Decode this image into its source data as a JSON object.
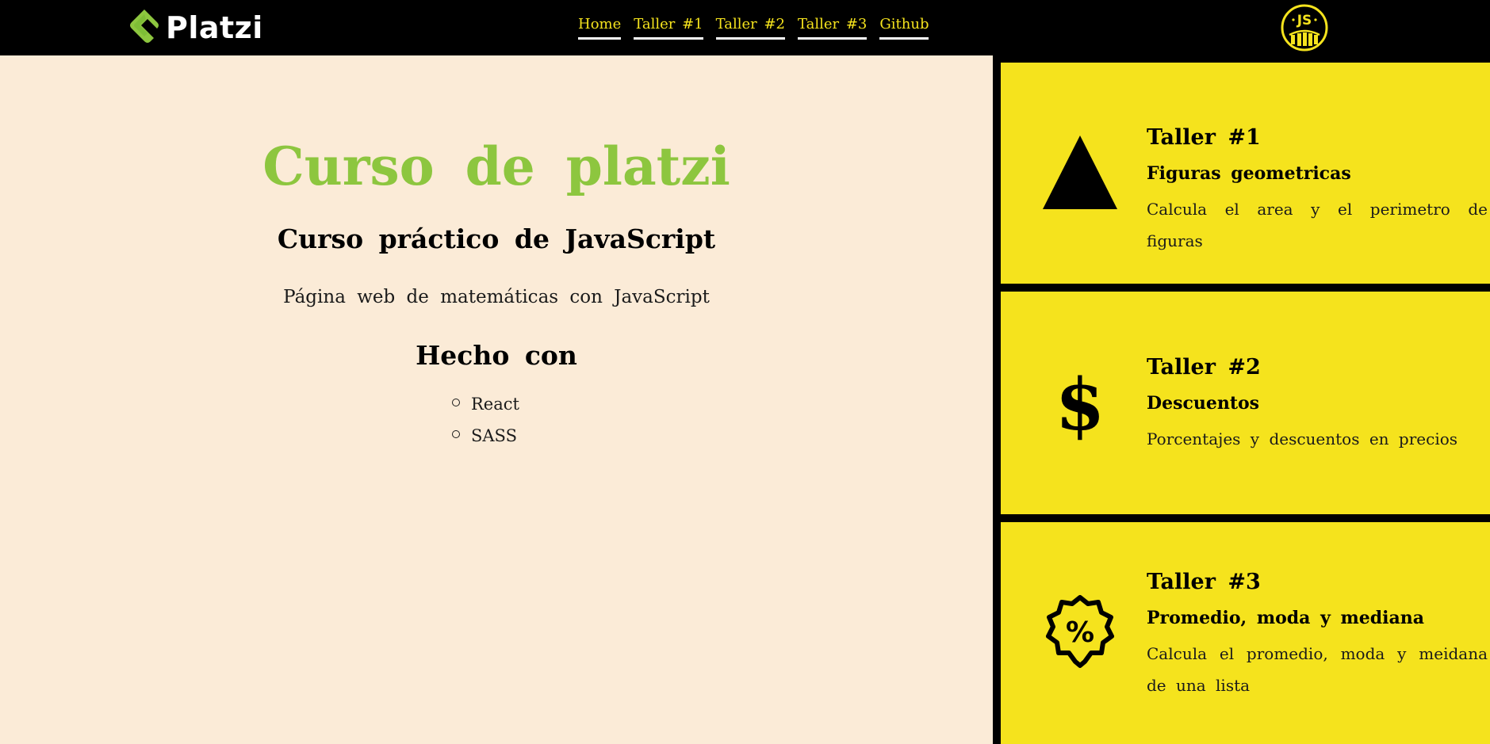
{
  "header": {
    "brand": "Platzi",
    "nav": [
      {
        "label": "Home"
      },
      {
        "label": "Taller #1"
      },
      {
        "label": "Taller #2"
      },
      {
        "label": "Taller #3"
      },
      {
        "label": "Github"
      }
    ],
    "badge_text": "JS"
  },
  "main": {
    "title": "Curso de platzi",
    "subtitle": "Curso práctico de JavaScript",
    "description": "Página web de matemáticas con JavaScript",
    "made_with_heading": "Hecho con",
    "technologies": [
      "React",
      "SASS"
    ]
  },
  "cards": [
    {
      "title": "Taller #1",
      "subtitle": "Figuras geometricas",
      "description": "Calcula el area y el perimetro de figuras",
      "icon": "triangle-icon"
    },
    {
      "title": "Taller #2",
      "subtitle": "Descuentos",
      "description": "Porcentajes y descuentos en precios",
      "icon": "dollar-icon"
    },
    {
      "title": "Taller #3",
      "subtitle": "Promedio, moda y mediana",
      "description": "Calcula el promedio, moda y meidana de una lista",
      "icon": "percent-badge-icon"
    }
  ],
  "colors": {
    "header_bg": "#000000",
    "nav_text": "#f5e31d",
    "brand_green": "#8dc63f",
    "page_bg": "#fbebd7",
    "card_bg": "#f5e31d"
  }
}
